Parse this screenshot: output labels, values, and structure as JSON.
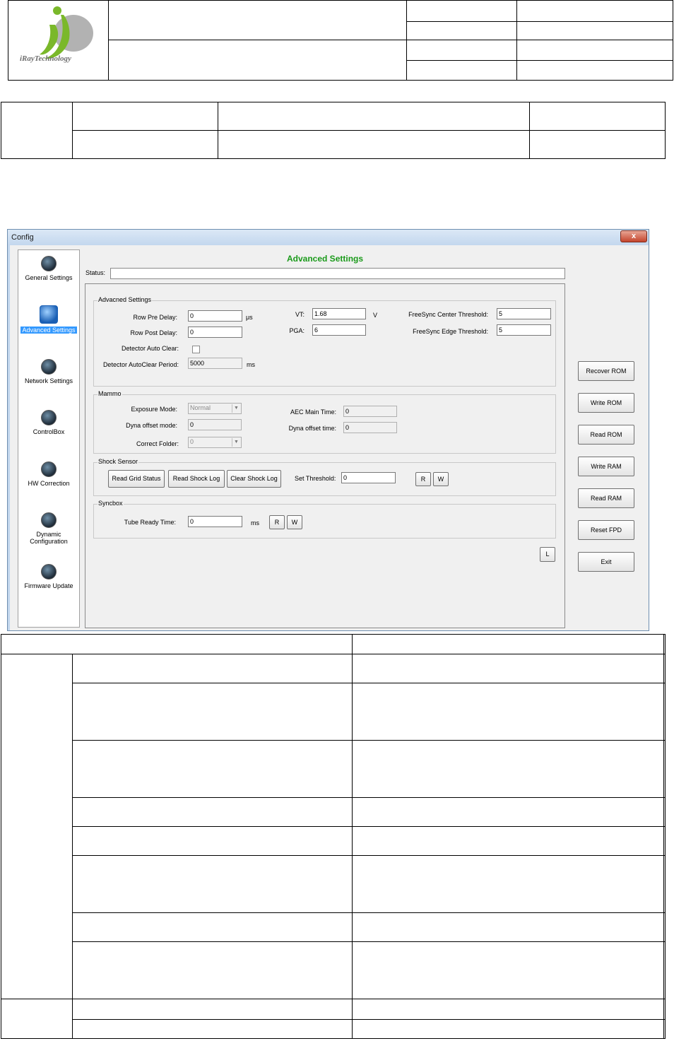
{
  "logo": {
    "brand_text": "iRayTechnology",
    "colors": {
      "green": "#7ab82a",
      "gray": "#a9a9a9"
    }
  },
  "window": {
    "title": "Config",
    "close_label": "x",
    "heading": "Advanced Settings",
    "status_label": "Status:",
    "status_value": "",
    "nav": [
      {
        "label": "General Settings",
        "icon": "general-settings-icon"
      },
      {
        "label": "Advanced Settings",
        "icon": "advanced-settings-icon",
        "selected": true
      },
      {
        "label": "Network Settings",
        "icon": "network-settings-icon"
      },
      {
        "label": "ControlBox",
        "icon": "controlbox-icon"
      },
      {
        "label": "HW Correction",
        "icon": "hw-correction-icon"
      },
      {
        "label": "Dynamic Configuration",
        "line1": "Dynamic",
        "line2": "Configuration",
        "icon": "dynamic-configuration-icon"
      },
      {
        "label": "Firmware Update",
        "icon": "firmware-update-icon"
      }
    ],
    "advanced": {
      "title": "Advacned Settings",
      "row_pre_delay_label": "Row Pre Delay:",
      "row_pre_delay_value": "0",
      "row_pre_delay_unit": "μs",
      "row_post_delay_label": "Row Post Delay:",
      "row_post_delay_value": "0",
      "detector_auto_clear_label": "Detector Auto Clear:",
      "detector_autoclear_period_label": "Detector AutoClear Period:",
      "detector_autoclear_period_value": "5000",
      "detector_autoclear_period_unit": "ms",
      "vt_label": "VT:",
      "vt_value": "1.68",
      "vt_unit": "V",
      "pga_label": "PGA:",
      "pga_value": "6",
      "freesync_center_label": "FreeSync Center Threshold:",
      "freesync_center_value": "5",
      "freesync_edge_label": "FreeSync Edge Threshold:",
      "freesync_edge_value": "5"
    },
    "mammo": {
      "title": "Mammo",
      "exposure_mode_label": "Exposure Mode:",
      "exposure_mode_value": "Normal",
      "dyna_offset_mode_label": "Dyna offset mode:",
      "dyna_offset_mode_value": "0",
      "correct_folder_label": "Correct Folder:",
      "correct_folder_value": "0",
      "aec_main_time_label": "AEC Main Time:",
      "aec_main_time_value": "0",
      "dyna_offset_time_label": "Dyna offset time:",
      "dyna_offset_time_value": "0"
    },
    "shock": {
      "title": "Shock Sensor",
      "read_grid_status": "Read Grid Status",
      "read_shock_log": "Read Shock Log",
      "clear_shock_log": "Clear Shock Log",
      "set_threshold_label": "Set Threshold:",
      "set_threshold_value": "0",
      "r_label": "R",
      "w_label": "W"
    },
    "syncbox": {
      "title": "Syncbox",
      "tube_ready_time_label": "Tube Ready Time:",
      "tube_ready_time_value": "0",
      "tube_ready_time_unit": "ms",
      "r_label": "R",
      "w_label": "W"
    },
    "l_button": "L",
    "side_buttons": {
      "recover_rom": "Recover ROM",
      "write_rom": "Write ROM",
      "read_rom": "Read ROM",
      "write_ram": "Write RAM",
      "read_ram": "Read RAM",
      "reset_fpd": "Reset FPD",
      "exit": "Exit"
    }
  }
}
